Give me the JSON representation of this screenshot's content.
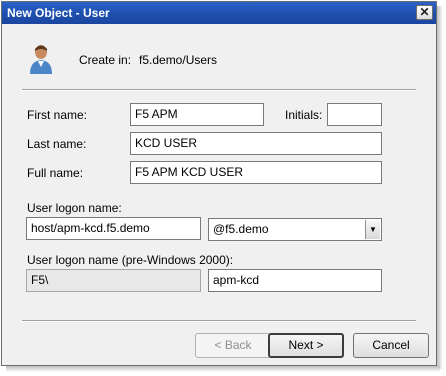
{
  "window": {
    "title": "New Object - User",
    "close_glyph": "✕"
  },
  "header": {
    "create_in_label": "Create in:",
    "create_in_path": "f5.demo/Users"
  },
  "form": {
    "first_name": {
      "label": "First name:",
      "value": "F5 APM"
    },
    "initials": {
      "label": "Initials:",
      "value": ""
    },
    "last_name": {
      "label": "Last name:",
      "value": "KCD USER"
    },
    "full_name": {
      "label": "Full name:",
      "value": "F5 APM KCD USER"
    },
    "logon_name": {
      "label": "User logon name:",
      "value": "host/apm-kcd.f5.demo"
    },
    "domain_suffix": {
      "selected": "@f5.demo"
    },
    "pre2000": {
      "label": "User logon name (pre-Windows 2000):",
      "domain": "F5\\",
      "value": "apm-kcd"
    }
  },
  "buttons": {
    "back": "< Back",
    "next": "Next >",
    "cancel": "Cancel"
  },
  "icons": {
    "user": "user-icon",
    "close": "close-icon",
    "dropdown": "chevron-down-icon"
  },
  "colors": {
    "titlebar": "#1f4fae",
    "dialog_bg": "#f0f0f0"
  }
}
